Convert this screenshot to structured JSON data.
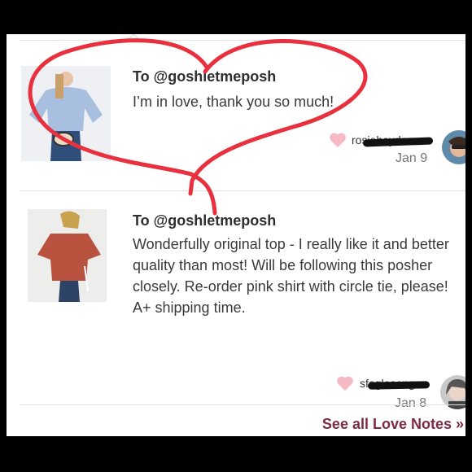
{
  "notes": [
    {
      "to": "To @goshletmeposh",
      "message": "I’m in love, thank you so much!",
      "user": "rosieheyden",
      "date": "Jan 9",
      "heart_color": "#f7b9c6"
    },
    {
      "to": "To @goshletmeposh",
      "message": "Wonderfully original top - I really like it and better quality than most! Will be following this posher closely. Re-order pink shirt with circle tie, please! A+ shipping time.",
      "user": "sfoglesong",
      "date": "Jan 8",
      "heart_color": "#f7b9c6"
    }
  ],
  "footer": {
    "see_all": "See all Love Notes »"
  },
  "colors": {
    "accent": "#7d2a45",
    "overlay_heart": "#e8303e"
  },
  "icons": {
    "heart": "heart-icon",
    "avatar": "user-avatar"
  }
}
